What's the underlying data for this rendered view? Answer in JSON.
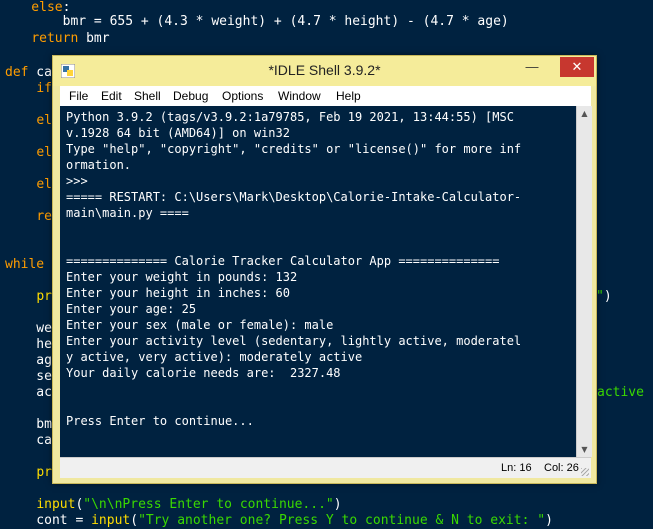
{
  "background_editor": {
    "lines": [
      {
        "text": "    else:",
        "cls": "kw-line"
      },
      {
        "text": "        bmr = 655 + (4.3 * weight) + (4.7 * height) - (4.7 * age)"
      },
      {
        "text": "    return bmr"
      },
      {
        "text": "def ca"
      },
      {
        "text": "    if"
      },
      {
        "text": "    el"
      },
      {
        "text": "    el"
      },
      {
        "text": "    el"
      },
      {
        "text": "    re"
      },
      {
        "text": "while"
      },
      {
        "text": "    pr"
      },
      {
        "text": "    we"
      },
      {
        "text": "    he"
      },
      {
        "text": "    ag"
      },
      {
        "text": "    se"
      },
      {
        "text": "    ac"
      },
      {
        "text": "    bm"
      },
      {
        "text": "    ca"
      },
      {
        "text": "    pr"
      },
      {
        "text": "    input(\"\\n\\nPress Enter to continue...\")"
      },
      {
        "text": "    cont = input(\"Try another one? Press Y to continue & N to exit: \")"
      }
    ],
    "right_fragments": {
      "pr_tail": "\")",
      "ac_tail": "active"
    }
  },
  "window": {
    "title": "*IDLE Shell 3.9.2*",
    "min_label": "—",
    "max_label": "□",
    "close_label": "✕",
    "menu": [
      "File",
      "Edit",
      "Shell",
      "Debug",
      "Options",
      "Window",
      "Help"
    ]
  },
  "shell": {
    "lines": [
      "Python 3.9.2 (tags/v3.9.2:1a79785, Feb 19 2021, 13:44:55) [MSC",
      "v.1928 64 bit (AMD64)] on win32",
      "Type \"help\", \"copyright\", \"credits\" or \"license()\" for more inf",
      "ormation.",
      ">>> ",
      "===== RESTART: C:\\Users\\Mark\\Desktop\\Calorie-Intake-Calculator-",
      "main\\main.py ====",
      "",
      "",
      "============== Calorie Tracker Calculator App ==============",
      "Enter your weight in pounds: 132",
      "Enter your height in inches: 60",
      "Enter your age: 25",
      "Enter your sex (male or female): male",
      "Enter your activity level (sedentary, lightly active, moderatel",
      "y active, very active): moderately active",
      "Your daily calorie needs are:  2327.48",
      "",
      "",
      "Press Enter to continue..."
    ]
  },
  "status": {
    "ln": "Ln: 16",
    "col": "Col: 26"
  },
  "colors": {
    "editor_bg": "#002240",
    "keyword": "#ff9d00",
    "string": "#3ad900",
    "builtin": "#ffdd00",
    "window_frame": "#f5ec9a",
    "close_red": "#c7372f"
  }
}
